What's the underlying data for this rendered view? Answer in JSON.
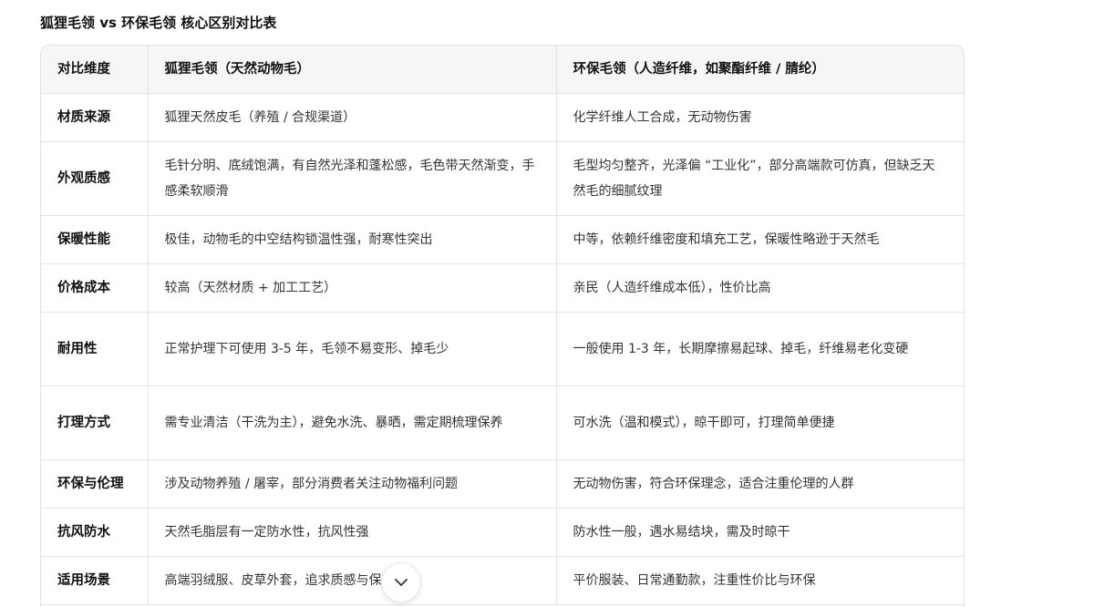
{
  "title": "狐狸毛领 vs 环保毛领 核心区别对比表",
  "table": {
    "headers": [
      "对比维度",
      "狐狸毛领（天然动物毛）",
      "环保毛领（人造纤维，如聚酯纤维 / 腈纶）"
    ],
    "rows": [
      [
        "材质来源",
        "狐狸天然皮毛（养殖 / 合规渠道）",
        "化学纤维人工合成，无动物伤害"
      ],
      [
        "外观质感",
        "毛针分明、底绒饱满，有自然光泽和蓬松感，毛色带天然渐变，手感柔软顺滑",
        "毛型均匀整齐，光泽偏 “工业化”，部分高端款可仿真，但缺乏天然毛的细腻纹理"
      ],
      [
        "保暖性能",
        "极佳，动物毛的中空结构锁温性强，耐寒性突出",
        "中等，依赖纤维密度和填充工艺，保暖性略逊于天然毛"
      ],
      [
        "价格成本",
        "较高（天然材质 + 加工工艺）",
        "亲民（人造纤维成本低），性价比高"
      ],
      [
        "耐用性",
        "正常护理下可使用 3-5 年，毛领不易变形、掉毛少",
        "一般使用 1-3 年，长期摩擦易起球、掉毛，纤维易老化变硬"
      ],
      [
        "打理方式",
        "需专业清洁（干洗为主），避免水洗、暴晒，需定期梳理保养",
        "可水洗（温和模式），晾干即可，打理简单便捷"
      ],
      [
        "环保与伦理",
        "涉及动物养殖 / 屠宰，部分消费者关注动物福利问题",
        "无动物伤害，符合环保理念，适合注重伦理的人群"
      ],
      [
        "抗风防水",
        "天然毛脂层有一定防水性，抗风性强",
        "防水性一般，遇水易结块，需及时晾干"
      ],
      [
        "适用场景",
        "高端羽绒服、皮草外套，追求质感与保暖",
        "平价服装、日常通勤款，注重性价比与环保"
      ]
    ]
  },
  "scroll_button": {
    "icon": "chevron-down-icon"
  }
}
